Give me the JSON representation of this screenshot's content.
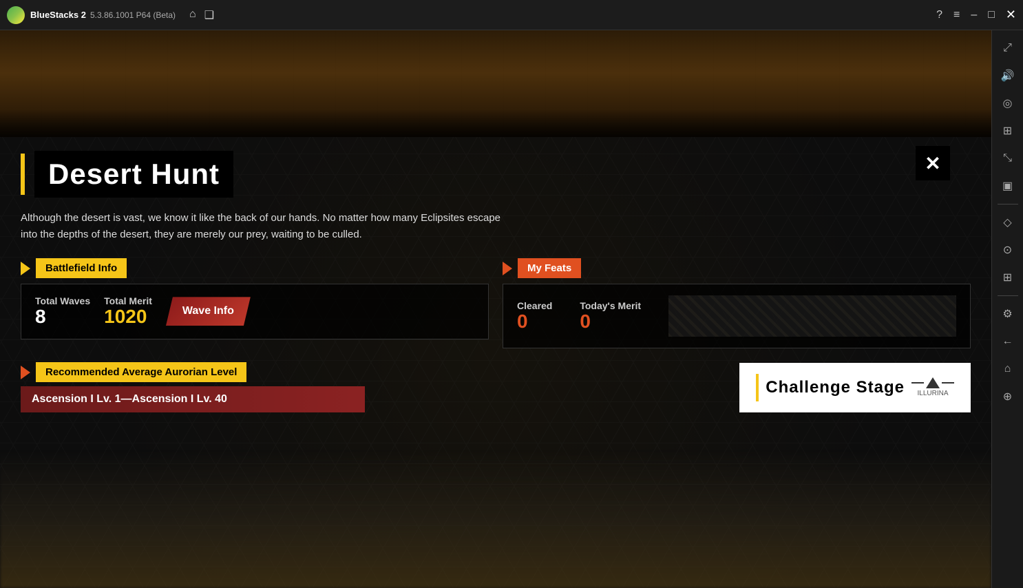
{
  "titlebar": {
    "app_name": "BlueStacks 2",
    "version": "5.3.86.1001 P64 (Beta)"
  },
  "game": {
    "title": "Desert Hunt",
    "description": "Although the desert is vast, we know it like the back of our hands. No matter how many Eclipsites escape into the depths of the desert, they are merely our prey, waiting to be culled.",
    "battlefield_info_label": "Battlefield Info",
    "my_feats_label": "My Feats",
    "total_waves_label": "Total Waves",
    "total_waves_value": "8",
    "total_merit_label": "Total Merit",
    "total_merit_value": "1020",
    "wave_info_label": "Wave Info",
    "cleared_label": "Cleared",
    "cleared_value": "0",
    "todays_merit_label": "Today's Merit",
    "todays_merit_value": "0",
    "rec_level_label": "Recommended Average Aurorian Level",
    "rec_level_range": "Ascension I Lv. 1—Ascension I Lv. 40",
    "challenge_stage_label": "Challenge Stage",
    "challenge_logo": "ILLURINA",
    "close_label": "✕"
  },
  "sidebar": {
    "icons": [
      "?",
      "≡",
      "–",
      "□",
      "✕",
      "⤢",
      "♪",
      "⊙",
      "⊞",
      "⤡",
      "□",
      "◇",
      "⊙",
      "⊞",
      "⚙",
      "←",
      "⌂",
      "⊕"
    ]
  }
}
